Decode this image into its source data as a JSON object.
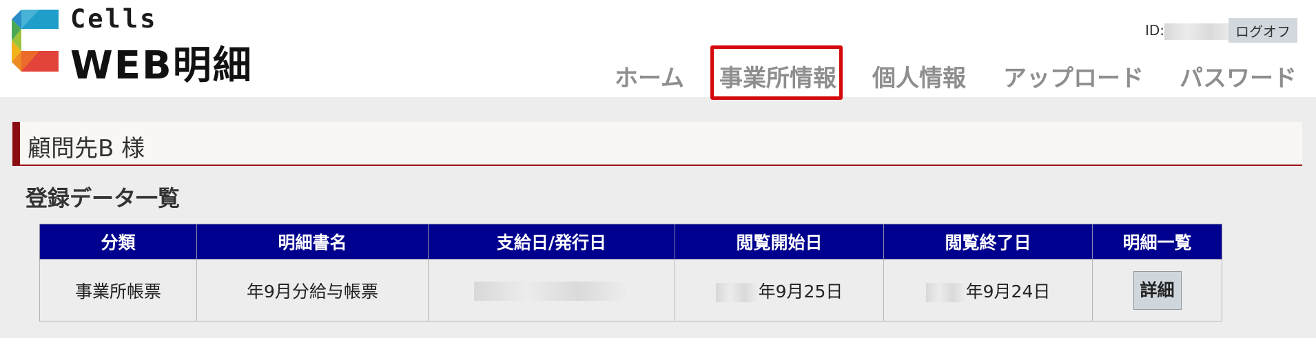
{
  "logo": {
    "brand": "Cells",
    "product": "WEB明細"
  },
  "header": {
    "id_label": "ID:",
    "logoff_label": "ログオフ"
  },
  "nav": {
    "items": [
      {
        "label": "ホーム"
      },
      {
        "label": "事業所情報"
      },
      {
        "label": "個人情報"
      },
      {
        "label": "アップロード"
      },
      {
        "label": "パスワード"
      }
    ]
  },
  "customer": {
    "name": "顧問先B 様"
  },
  "section": {
    "title": "登録データ一覧"
  },
  "table": {
    "headers": [
      "分類",
      "明細書名",
      "支給日/発行日",
      "閲覧開始日",
      "閲覧終了日",
      "明細一覧"
    ],
    "rows": [
      {
        "category": "事業所帳票",
        "name": "年9月分給与帳票",
        "view_start": "年9月25日",
        "view_end": "年9月24日",
        "detail_label": "詳細"
      }
    ]
  },
  "colors": {
    "header_bg": "#00008f",
    "accent_red": "#d4090c",
    "customer_bar_accent": "#8a0d12"
  }
}
